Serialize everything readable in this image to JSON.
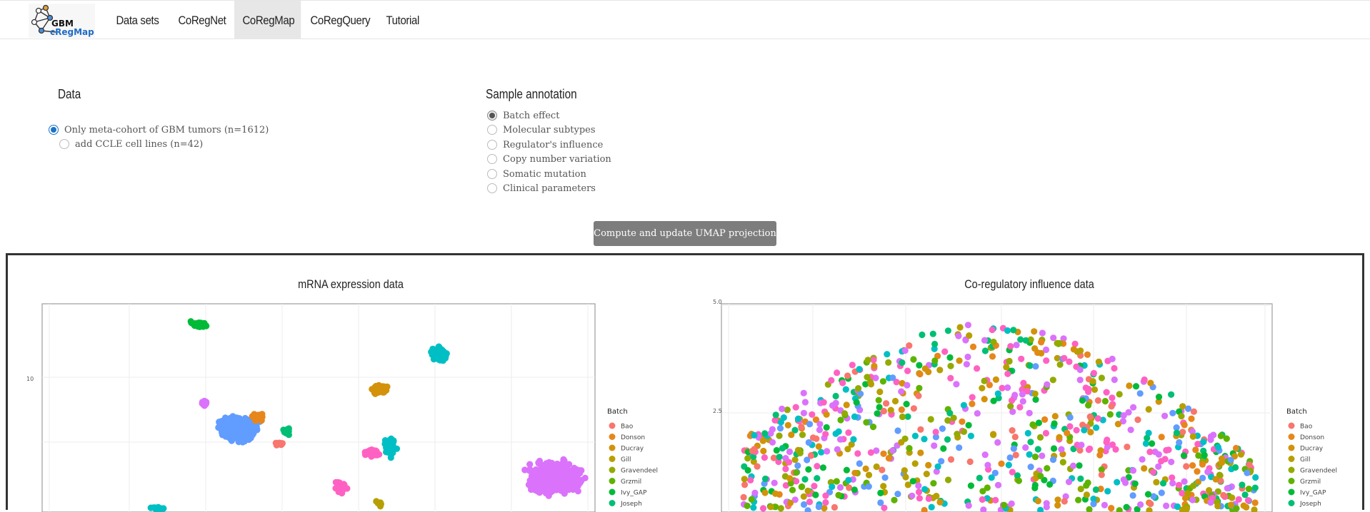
{
  "nav": {
    "logo_text_top": "GBM",
    "logo_text_bottom": "cRegMap",
    "items": [
      "Data sets",
      "CoRegNet",
      "CoRegMap",
      "CoRegQuery",
      "Tutorial"
    ],
    "active": "CoRegMap"
  },
  "data_section": {
    "heading": "Data",
    "options": [
      {
        "label": "Only meta-cohort of GBM tumors (n=1612)",
        "checked": true
      },
      {
        "label": "add CCLE cell lines (n=42)",
        "checked": false
      }
    ]
  },
  "annotation_section": {
    "heading": "Sample annotation",
    "options": [
      {
        "label": "Batch effect",
        "checked": true
      },
      {
        "label": "Molecular subtypes",
        "checked": false
      },
      {
        "label": "Regulator's influence",
        "checked": false
      },
      {
        "label": "Copy number variation",
        "checked": false
      },
      {
        "label": "Somatic mutation",
        "checked": false
      },
      {
        "label": "Clinical parameters",
        "checked": false
      }
    ]
  },
  "compute_button": "Compute and update UMAP projection",
  "plots": [
    {
      "title": "mRNA expression data",
      "y_ticks": [
        "10"
      ],
      "legend_title": "Batch",
      "legend": [
        "Bao",
        "Donson",
        "Ducray",
        "Gill",
        "Gravendeel",
        "Grzmil",
        "Ivy_GAP",
        "Joseph"
      ]
    },
    {
      "title": "Co-regulatory influence data",
      "y_ticks": [
        "5.0",
        "2.5"
      ],
      "legend_title": "Batch",
      "legend": [
        "Bao",
        "Donson",
        "Ducray",
        "Gill",
        "Gravendeel",
        "Grzmil",
        "Ivy_GAP",
        "Joseph"
      ]
    }
  ],
  "colors": {
    "Bao": "#F8766D",
    "Donson": "#E7861B",
    "Ducray": "#D3920A",
    "Gill": "#B79F00",
    "Gravendeel": "#93AA00",
    "Grzmil": "#5EB300",
    "Ivy_GAP": "#00BA38",
    "Joseph": "#00BF74",
    "cyan": "#00BFC4",
    "blue": "#619CFF",
    "purple": "#DB72FB",
    "magenta": "#FF61C3",
    "button": "#7d7d7d",
    "radio_blue": "#1a73c8"
  }
}
